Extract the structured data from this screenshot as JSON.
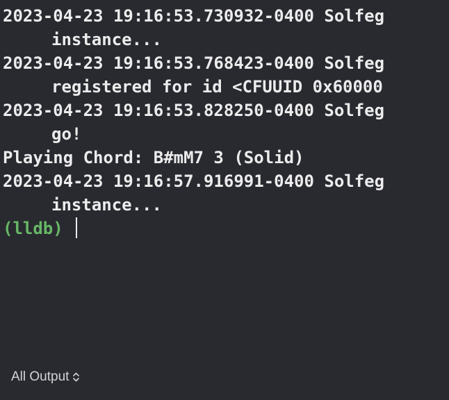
{
  "log": {
    "lines": [
      {
        "text": "2023-04-23 19:16:53.730932-0400 Solfeg",
        "cont": false
      },
      {
        "text": "instance...",
        "cont": true
      },
      {
        "text": "2023-04-23 19:16:53.768423-0400 Solfeg",
        "cont": false
      },
      {
        "text": "registered for id <CFUUID 0x60000",
        "cont": true
      },
      {
        "text": "2023-04-23 19:16:53.828250-0400 Solfeg",
        "cont": false
      },
      {
        "text": "go!",
        "cont": true
      },
      {
        "text": "Playing Chord: B#mM7 3 (Solid)",
        "cont": false
      },
      {
        "text": "2023-04-23 19:16:57.916991-0400 Solfeg",
        "cont": false
      },
      {
        "text": "instance...",
        "cont": true
      }
    ],
    "prompt": "(lldb)"
  },
  "footer": {
    "scope_label": "All Output",
    "scope_icon": "chevron-up-down-icon"
  },
  "colors": {
    "background": "#292a30",
    "text": "#ececed",
    "prompt": "#67b766"
  }
}
